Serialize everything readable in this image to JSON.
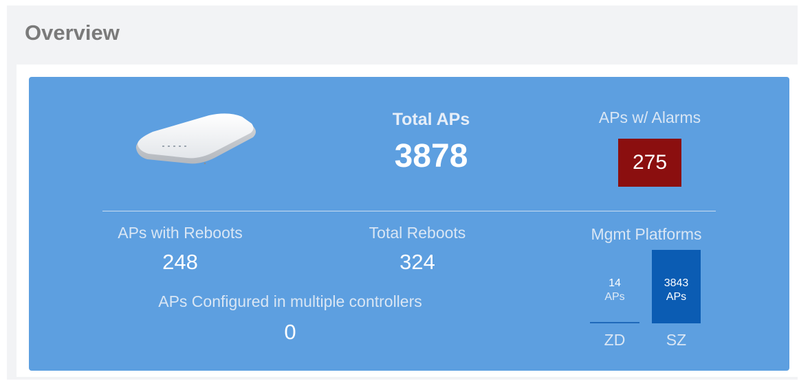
{
  "header": {
    "title": "Overview"
  },
  "overview": {
    "total_aps_label": "Total APs",
    "total_aps_value": "3878",
    "alarms_label": "APs w/ Alarms",
    "alarms_value": "275",
    "reboots_aps_label": "APs with Reboots",
    "reboots_aps_value": "248",
    "total_reboots_label": "Total Reboots",
    "total_reboots_value": "324",
    "multi_ctrl_label": "APs Configured in multiple controllers",
    "multi_ctrl_value": "0",
    "mgmt_label": "Mgmt Platforms"
  },
  "mgmt_platforms": {
    "zd": {
      "count": "14",
      "unit": "APs",
      "label": "ZD"
    },
    "sz": {
      "count": "3843",
      "unit": "APs",
      "label": "SZ"
    }
  },
  "colors": {
    "panel": "#5d9fe0",
    "alarm": "#8b0f0f",
    "sz_bar": "#0b5cb3"
  },
  "icons": {
    "device": "access-point-device-icon"
  }
}
